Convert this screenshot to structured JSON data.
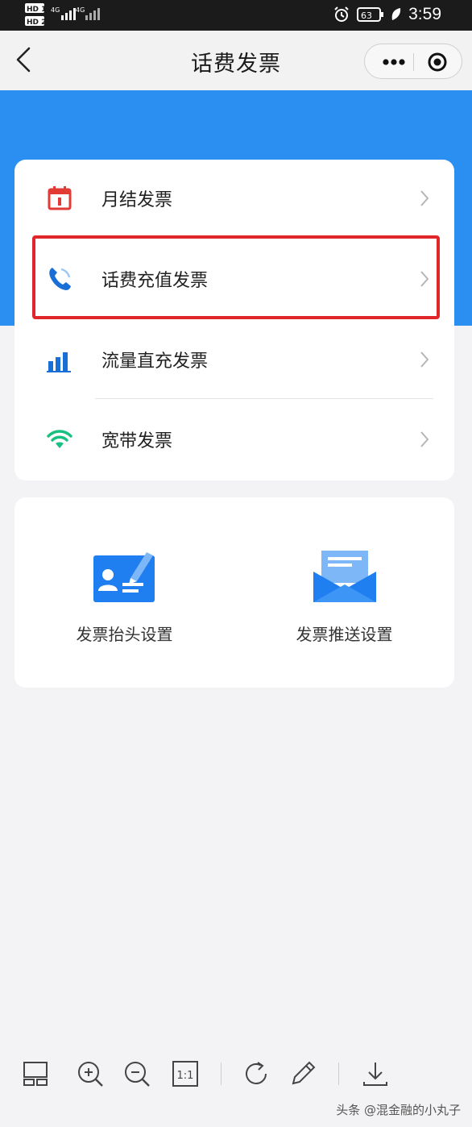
{
  "status_bar": {
    "network_left": "4G",
    "network_right": "4G",
    "battery": "63",
    "time": "3:59",
    "icons": [
      "sim-icon",
      "signal-icon",
      "alarm-icon",
      "battery-icon",
      "charging-leaf-icon"
    ]
  },
  "nav": {
    "title": "话费发票",
    "back_icon": "back-arrow-icon",
    "more_icon": "more-dots-icon",
    "close_icon": "miniprogram-target-icon"
  },
  "menu": {
    "items": [
      {
        "label": "月结发票",
        "icon": "calendar-icon",
        "icon_color": "#e23b35"
      },
      {
        "label": "话费充值发票",
        "icon": "phone-icon",
        "icon_color": "#1a6fd6",
        "highlighted": true
      },
      {
        "label": "流量直充发票",
        "icon": "bar-chart-icon",
        "icon_color": "#1a6fd6"
      },
      {
        "label": "宽带发票",
        "icon": "wifi-icon",
        "icon_color": "#19c081"
      }
    ],
    "highlight_color": "#e0262a"
  },
  "settings": {
    "items": [
      {
        "label": "发票抬头设置",
        "icon": "id-card-icon"
      },
      {
        "label": "发票推送设置",
        "icon": "envelope-icon"
      }
    ]
  },
  "toolbar": {
    "items": [
      "layout-icon",
      "zoom-in-icon",
      "zoom-out-icon",
      "actual-size-icon",
      "rotate-icon",
      "edit-icon",
      "download-icon"
    ],
    "actual_size_label": "1:1"
  },
  "watermark": "头条 @混金融的小丸子",
  "colors": {
    "brand_blue": "#2b8ff2",
    "page_bg": "#f3f3f5"
  }
}
